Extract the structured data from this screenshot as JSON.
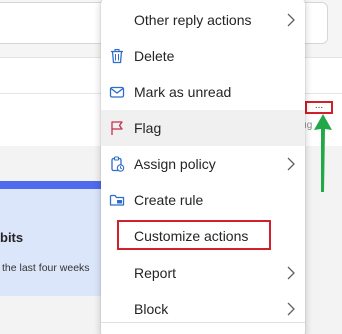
{
  "menu": {
    "items": [
      {
        "label": "Other reply actions",
        "icon": "reply-icon",
        "has_submenu": true
      },
      {
        "label": "Delete",
        "icon": "trash-icon",
        "has_submenu": false
      },
      {
        "label": "Mark as unread",
        "icon": "envelope-icon",
        "has_submenu": false
      },
      {
        "label": "Flag",
        "icon": "flag-icon",
        "has_submenu": false
      },
      {
        "label": "Assign policy",
        "icon": "policy-icon",
        "has_submenu": true
      },
      {
        "label": "Create rule",
        "icon": "rule-folder-icon",
        "has_submenu": false
      },
      {
        "label": "Customize actions",
        "icon": "",
        "has_submenu": false
      },
      {
        "label": "Report",
        "icon": "",
        "has_submenu": true
      },
      {
        "label": "Block",
        "icon": "",
        "has_submenu": true
      }
    ]
  },
  "more_button": {
    "label": "..."
  },
  "background": {
    "card_title": "bits",
    "card_text": "the last four weeks"
  },
  "colors": {
    "highlight_red": "#d0202c",
    "arrow_green": "#22a849",
    "icon_blue": "#2f6ec8",
    "flag_red": "#c4314b",
    "card_blue": "#dbe6fb",
    "card_accent": "#4f6bed"
  }
}
